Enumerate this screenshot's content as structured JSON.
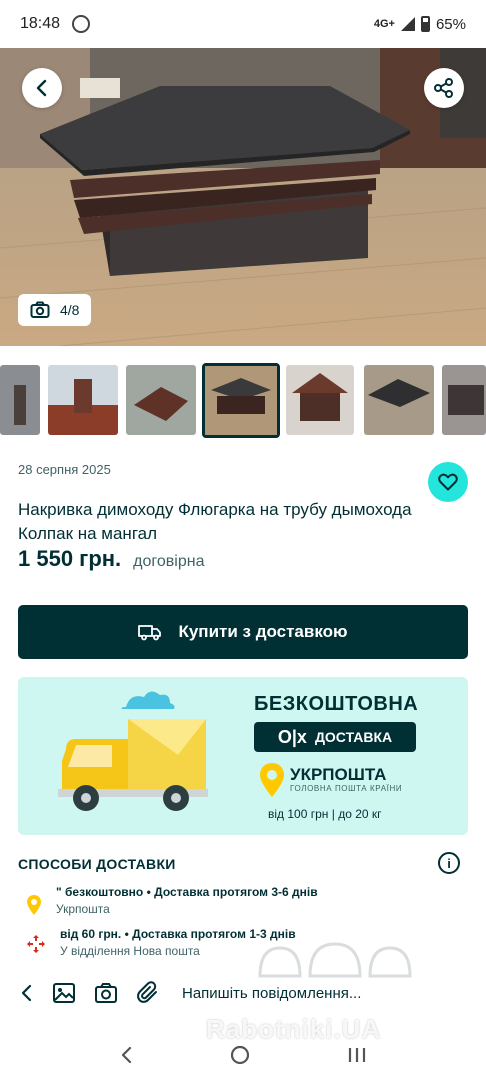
{
  "status": {
    "time": "18:48",
    "network": "4G+",
    "battery": "65%"
  },
  "gallery": {
    "counter": "4/8",
    "selected_thumb": 4
  },
  "listing": {
    "date": "28 серпня 2025",
    "title": "Накривка димоходу  Флюгарка на трубу дымохода Колпак на мангал",
    "price": "1 550 грн.",
    "price_note": "договірна"
  },
  "buy_button": {
    "label": "Купити з доставкою"
  },
  "promo": {
    "headline": "БЕЗКОШТОВНА",
    "olx_logo": "O|x",
    "olx_delivery": "ДОСТАВКА",
    "carrier": "УКРПОШТА",
    "carrier_sub": "ГОЛОВНА ПОШТА КРАЇНИ",
    "limits": "від 100 грн | до 20 кг"
  },
  "delivery": {
    "title": "СПОСОБИ ДОСТАВКИ",
    "options": [
      {
        "main": "\"  безкоштовно • Доставка протягом 3-6 днів",
        "sub": "Укрпошта"
      },
      {
        "main": "від 60 грн. • Доставка протягом 1-3 днів",
        "sub": "У відділення Нова пошта"
      }
    ]
  },
  "message_bar": {
    "placeholder": "Напишіть повідомлення..."
  },
  "watermark": "Rabotniki.UA",
  "colors": {
    "primary": "#002f34",
    "accent": "#23e5db",
    "promo_bg": "#cff7f1",
    "ukrposhta_yellow": "#ffc800",
    "novaposhta_red": "#da291c"
  },
  "icons": [
    "back-arrow-icon",
    "share-icon",
    "camera-icon",
    "heart-icon",
    "truck-icon",
    "info-icon",
    "location-pin-icon",
    "nova-poshta-icon",
    "chevron-left-icon",
    "image-icon",
    "paperclip-icon",
    "nav-back-icon",
    "nav-home-icon",
    "nav-recents-icon"
  ]
}
